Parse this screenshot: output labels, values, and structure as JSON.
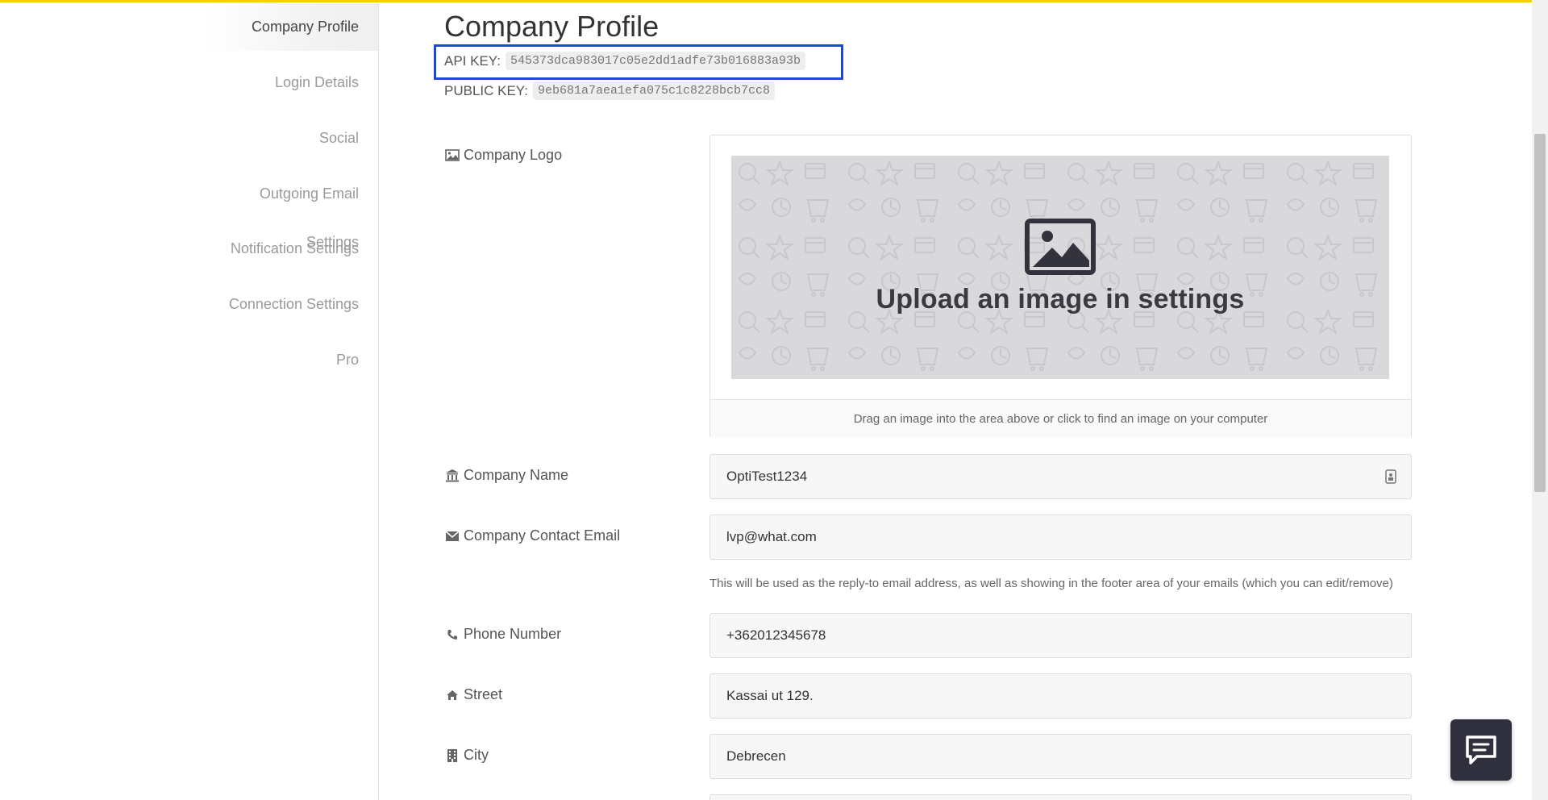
{
  "colors": {
    "accent": "#f5d000",
    "highlight": "#1f48d6",
    "chat_bg": "#2f2f3e"
  },
  "sidebar": {
    "items": [
      {
        "label": "Company Profile",
        "active": true
      },
      {
        "label": "Login Details"
      },
      {
        "label": "Social"
      },
      {
        "label": "Outgoing Email Settings"
      },
      {
        "label": "Notification Settings"
      },
      {
        "label": "Connection Settings"
      },
      {
        "label": "Pro"
      }
    ]
  },
  "main": {
    "title": "Company Profile",
    "api_key_label": "API KEY:",
    "api_key": "545373dca983017c05e2dd1adfe73b016883a93b",
    "public_key_label": "PUBLIC KEY:",
    "public_key": "9eb681a7aea1efa075c1c8228bcb7cc8",
    "logo": {
      "label": "Company Logo",
      "icon": "image-icon",
      "upload_text": "Upload an image in settings",
      "hint": "Drag an image into the area above or click to find an image on your computer"
    },
    "fields": {
      "company_name": {
        "label": "Company Name",
        "icon": "bank-icon",
        "value": "OptiTest1234"
      },
      "contact_email": {
        "label": "Company Contact Email",
        "icon": "envelope-icon",
        "value": "lvp@what.com",
        "help": "This will be used as the reply-to email address, as well as showing in the footer area of your emails (which you can edit/remove)"
      },
      "phone": {
        "label": "Phone Number",
        "icon": "phone-icon",
        "value": "+362012345678"
      },
      "street": {
        "label": "Street",
        "icon": "home-icon",
        "value": "Kassai ut 129."
      },
      "city": {
        "label": "City",
        "icon": "building-icon",
        "value": "Debrecen"
      }
    }
  }
}
